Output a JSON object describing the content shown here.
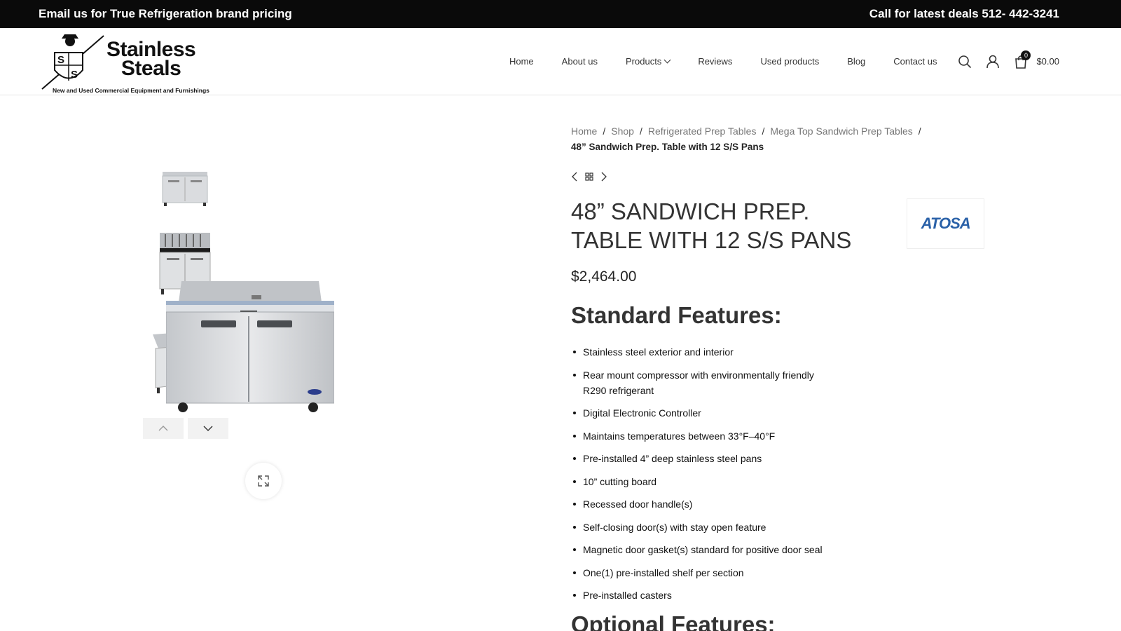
{
  "topbar": {
    "left_text": "Email us for True Refrigeration brand pricing",
    "right_text": "Call for latest deals 512- 442-3241"
  },
  "logo": {
    "line1": "Stainless",
    "line2": "Steals",
    "tagline": "New and Used Commercial Equipment and Furnishings",
    "mark_letters": "SS"
  },
  "nav": {
    "items": [
      {
        "label": "Home"
      },
      {
        "label": "About us"
      },
      {
        "label": "Products"
      },
      {
        "label": "Reviews"
      },
      {
        "label": "Used products"
      },
      {
        "label": "Blog"
      },
      {
        "label": "Contact us"
      }
    ],
    "cart_count": "0",
    "cart_total": "$0.00"
  },
  "breadcrumb": {
    "items": [
      "Home",
      "Shop",
      "Refrigerated Prep Tables",
      "Mega Top Sandwich Prep Tables"
    ],
    "current": "48” Sandwich Prep. Table with 12 S/S Pans"
  },
  "product": {
    "title": "48” Sandwich Prep. Table with 12 S/S Pans",
    "price": "$2,464.00",
    "brand": "ATOSA",
    "standard_heading": "Standard Features:",
    "features": [
      "Stainless steel exterior and interior",
      " Rear mount compressor with environmentally friendly R290 refrigerant",
      " Digital Electronic Controller",
      " Maintains temperatures between 33°F–40°F",
      " Pre-installed 4” deep stainless steel pans",
      " 10” cutting board",
      " Recessed door handle(s)",
      " Self-closing door(s) with stay open feature",
      " Magnetic door gasket(s) standard for positive door seal",
      " One(1) pre-installed shelf per section",
      " Pre-installed casters"
    ],
    "optional_heading": "Optional Features:"
  },
  "colors": {
    "topbar_bg": "#0a0a0a",
    "brand_blue": "#2a61a8",
    "text": "#242424"
  }
}
